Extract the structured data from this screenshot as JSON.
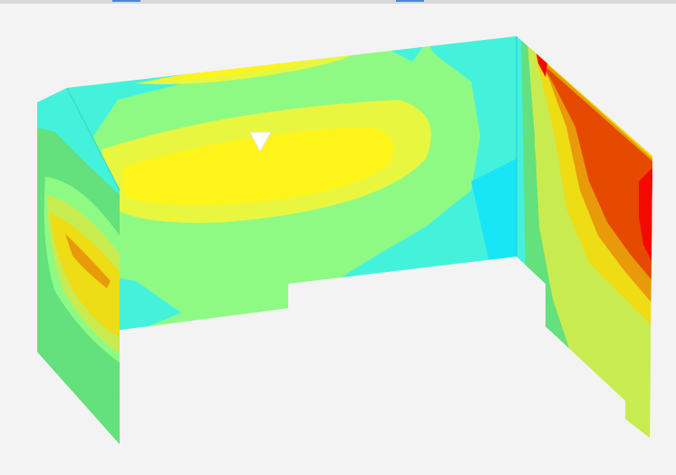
{
  "viewer": {
    "scene": "3d-contour-plot-three-walls",
    "background": "#f3f3f3",
    "contour_palette": [
      "#18e6f6",
      "#44f2dc",
      "#64e07c",
      "#8efa84",
      "#c8ec50",
      "#e8f640",
      "#fff41a",
      "#eedc14",
      "#e89a0a",
      "#e64a00",
      "#f20a00"
    ],
    "marker_icon": "triangle-down-icon"
  }
}
